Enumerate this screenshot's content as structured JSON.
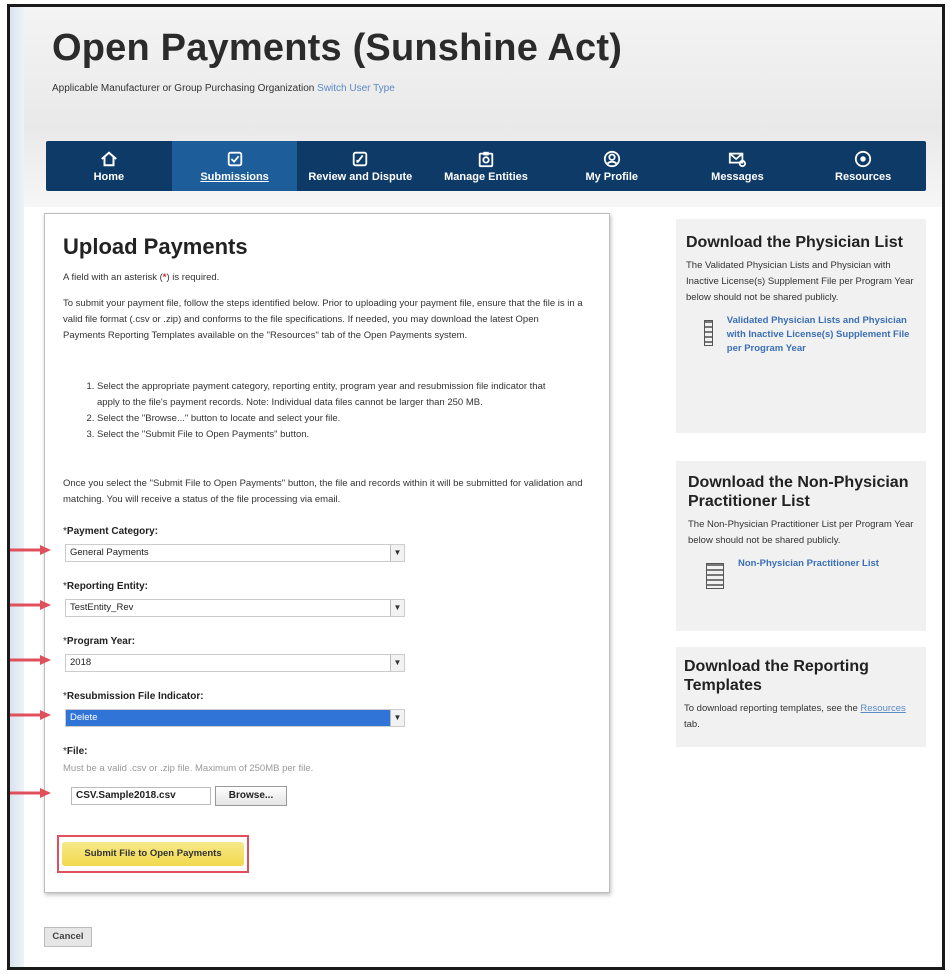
{
  "header": {
    "title": "Open Payments (Sunshine Act)",
    "subtitle": "Applicable Manufacturer or Group Purchasing Organization",
    "switch_link": "Switch User Type"
  },
  "nav": {
    "items": [
      {
        "label": "Home",
        "icon": "home-icon",
        "active": false
      },
      {
        "label": "Submissions",
        "icon": "submissions-icon",
        "active": true
      },
      {
        "label": "Review and Dispute",
        "icon": "review-icon",
        "active": false
      },
      {
        "label": "Manage Entities",
        "icon": "manage-entities-icon",
        "active": false
      },
      {
        "label": "My Profile",
        "icon": "profile-icon",
        "active": false
      },
      {
        "label": "Messages",
        "icon": "messages-icon",
        "active": false
      },
      {
        "label": "Resources",
        "icon": "resources-icon",
        "active": false
      }
    ]
  },
  "upload": {
    "heading": "Upload Payments",
    "required_note_pre": "A field with an asterisk (",
    "required_note_ast": "*",
    "required_note_post": ") is required.",
    "intro": "To submit your payment file, follow the steps identified below. Prior to uploading your payment file, ensure that the file is in a valid file format (.csv or .zip) and conforms to the file specifications. If needed, you may download the latest Open Payments Reporting Templates available on the \"Resources\" tab of the Open Payments system.",
    "steps": [
      "Select the appropriate payment category, reporting entity, program year and resubmission file indicator that apply to the file's payment records. Note: Individual data files cannot be larger than 250 MB.",
      "Select the \"Browse...\" button to locate and select your file.",
      "Select the \"Submit File to Open Payments\" button."
    ],
    "outro": "Once you select the \"Submit File to Open Payments\" button, the file and records within it will be submitted for validation and matching. You will receive a status of the file processing via email.",
    "fields": {
      "payment_category": {
        "label": "Payment Category:",
        "value": "General Payments"
      },
      "reporting_entity": {
        "label": "Reporting Entity:",
        "value": "TestEntity_Rev"
      },
      "program_year": {
        "label": "Program Year:",
        "value": "2018"
      },
      "resubmission": {
        "label": "Resubmission File Indicator:",
        "value": "Delete"
      },
      "file": {
        "label": "File:",
        "hint": "Must be a valid .csv or .zip file. Maximum of 250MB per file.",
        "value": "CSV.Sample2018.csv",
        "browse_label": "Browse..."
      }
    },
    "submit_label": "Submit File to Open Payments",
    "cancel_label": "Cancel"
  },
  "sidebar": {
    "physician": {
      "heading": "Download the Physician List",
      "text": "The Validated Physician Lists and Physician with Inactive License(s) Supplement File per Program Year below should not be shared publicly.",
      "link": "Validated Physician Lists and Physician with Inactive License(s) Supplement File per Program Year"
    },
    "non_physician": {
      "heading": "Download the Non-Physician Practitioner List",
      "text": "The Non-Physician Practitioner List per Program Year below should not be shared publicly.",
      "link": "Non-Physician Practitioner List"
    },
    "templates": {
      "heading": "Download the Reporting Templates",
      "text_pre": "To download reporting templates, see the",
      "link": "Resources",
      "text_post": "tab."
    }
  },
  "colors": {
    "nav_bg": "#0e3a68",
    "nav_active": "#1d5d9a",
    "submit_bg": "#f1d94b",
    "annotation_red": "#e0505c",
    "selected_option": "#2f74d6"
  }
}
